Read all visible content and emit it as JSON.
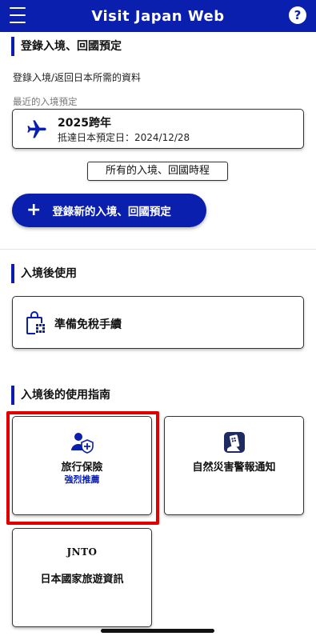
{
  "header": {
    "title": "Visit Japan Web",
    "help_label": "?"
  },
  "entry_section": {
    "title": "登錄入境、回國預定",
    "description": "登錄入境/返回日本所需的資料",
    "recent_label": "最近的入境預定",
    "plan": {
      "name": "2025跨年",
      "date_text": "抵達日本預定日：2024/12/28"
    },
    "all_schedules_button": "所有的入境、回國時程",
    "new_plan_button": "登錄新的入境、回國預定"
  },
  "after_entry_section": {
    "title": "入境後使用",
    "dutyfree_label": "準備免稅手續"
  },
  "guide_section": {
    "title": "入境後的使用指南",
    "cards": [
      {
        "label": "旅行保險",
        "sub": "強烈推薦"
      },
      {
        "label": "自然災害警報通知"
      },
      {
        "label": "日本國家旅遊資訊",
        "logo_text": "JNTO"
      }
    ]
  },
  "colors": {
    "brand": "#0a1fae",
    "highlight": "#e00000"
  }
}
